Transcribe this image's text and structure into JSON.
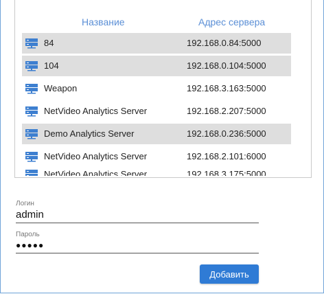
{
  "table": {
    "headers": {
      "name": "Название",
      "address": "Адрес сервера"
    },
    "rows": [
      {
        "name": "84",
        "address": "192.168.0.84:5000",
        "selected": true
      },
      {
        "name": "104",
        "address": "192.168.0.104:5000",
        "selected": true
      },
      {
        "name": "Weapon",
        "address": "192.168.3.163:5000",
        "selected": false
      },
      {
        "name": "NetVideo Analytics Server",
        "address": "192.168.2.207:5000",
        "selected": false
      },
      {
        "name": "Demo Analytics Server",
        "address": "192.168.0.236:5000",
        "selected": true
      },
      {
        "name": "NetVideo Analytics Server",
        "address": "192.168.2.101:6000",
        "selected": false
      },
      {
        "name": "NetVideo Analytics Server",
        "address": "192.168.3.175:5000",
        "selected": false
      }
    ]
  },
  "login": {
    "label": "Логин",
    "value": "admin"
  },
  "password": {
    "label": "Пароль",
    "value": "●●●●●"
  },
  "actions": {
    "add_label": "Добавить"
  },
  "colors": {
    "accent": "#2f7bd5",
    "header": "#5b8fd6",
    "selected_row": "#dedede"
  },
  "icons": {
    "row_icon": "server-icon"
  }
}
